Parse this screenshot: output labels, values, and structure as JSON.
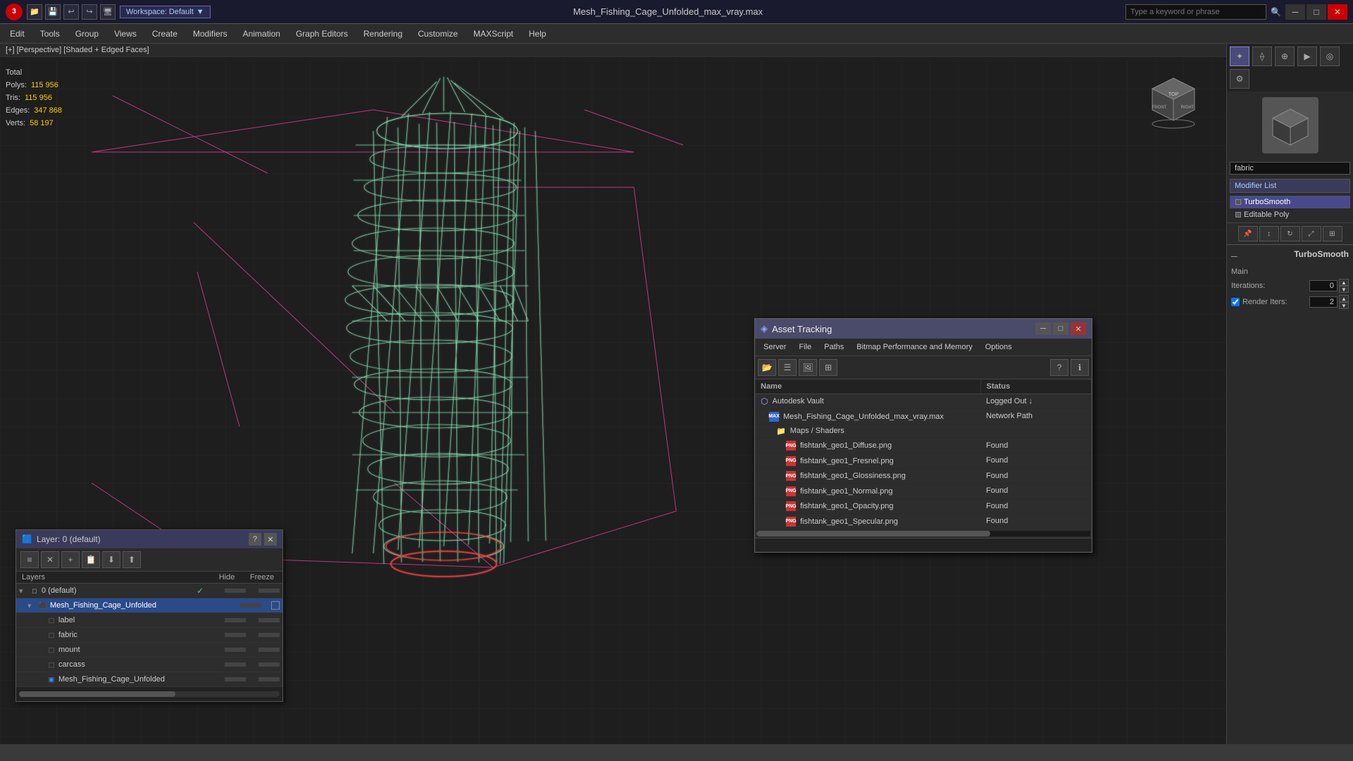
{
  "titleBar": {
    "logoText": "3",
    "quickAccess": [
      "📁",
      "💾",
      "↩",
      "↪",
      "🖥"
    ],
    "workspace": "Workspace: Default",
    "fileTitle": "Mesh_Fishing_Cage_Unfolded_max_vray.max",
    "searchPlaceholder": "Type a keyword or phrase",
    "winControls": [
      "─",
      "□",
      "✕"
    ]
  },
  "menuBar": {
    "items": [
      "Edit",
      "Tools",
      "Group",
      "Views",
      "Create",
      "Modifiers",
      "Animation",
      "Graph Editors",
      "Rendering",
      "Customize",
      "MAXScript",
      "Help"
    ]
  },
  "viewportLabel": "[+] [Perspective] [Shaded + Edged Faces]",
  "stats": {
    "total": "Total",
    "polys": {
      "label": "Polys:",
      "value": "115 956"
    },
    "tris": {
      "label": "Tris:",
      "value": "115 956"
    },
    "edges": {
      "label": "Edges:",
      "value": "347 868"
    },
    "verts": {
      "label": "Verts:",
      "value": "58 197"
    }
  },
  "rightPanel": {
    "modifierSearch": "fabric",
    "modifierListLabel": "Modifier List",
    "modifiers": [
      {
        "name": "TurboSmooth",
        "selected": true
      },
      {
        "name": "Editable Poly",
        "selected": false
      }
    ],
    "turboSmooth": {
      "title": "TurboSmooth",
      "section": "Main",
      "iterations": {
        "label": "Iterations:",
        "value": "0"
      },
      "renderIters": {
        "label": "Render Iters:",
        "value": "2"
      }
    }
  },
  "layerPanel": {
    "title": "Layer: 0 (default)",
    "toolbar": [
      "≡≡",
      "✕",
      "+",
      "📋",
      "⬇",
      "⬆"
    ],
    "columns": {
      "name": "Layers",
      "hide": "Hide",
      "freeze": "Freeze"
    },
    "items": [
      {
        "indent": 0,
        "name": "0 (default)",
        "check": "✓",
        "hasFreeze": true,
        "hasBox": false
      },
      {
        "indent": 1,
        "name": "Mesh_Fishing_Cage_Unfolded",
        "selected": true,
        "check": "",
        "hasFreeze": true,
        "hasBox": true
      },
      {
        "indent": 2,
        "name": "label",
        "check": "",
        "hasFreeze": true,
        "hasBox": false
      },
      {
        "indent": 2,
        "name": "fabric",
        "check": "",
        "hasFreeze": true,
        "hasBox": false
      },
      {
        "indent": 2,
        "name": "mount",
        "check": "",
        "hasFreeze": true,
        "hasBox": false
      },
      {
        "indent": 2,
        "name": "carcass",
        "check": "",
        "hasFreeze": true,
        "hasBox": false
      },
      {
        "indent": 2,
        "name": "Mesh_Fishing_Cage_Unfolded",
        "check": "",
        "hasFreeze": true,
        "hasBox": false
      }
    ]
  },
  "assetPanel": {
    "title": "Asset Tracking",
    "menuItems": [
      "Server",
      "File",
      "Paths",
      "Bitmap Performance and Memory",
      "Options"
    ],
    "toolbar": [
      "📂",
      "📋",
      "🖼",
      "☰"
    ],
    "columns": {
      "name": "Name",
      "status": "Status"
    },
    "groups": [
      {
        "name": "Autodesk Vault",
        "icon": "vault",
        "status": "Logged Out ↓",
        "children": [
          {
            "name": "Mesh_Fishing_Cage_Unfolded_max_vray.max",
            "icon": "max-file",
            "status": "Network Path"
          },
          {
            "name": "Maps / Shaders",
            "icon": "folder",
            "status": "",
            "children": [
              {
                "name": "fishtank_geo1_Diffuse.png",
                "icon": "png",
                "status": "Found"
              },
              {
                "name": "fishtank_geo1_Fresnel.png",
                "icon": "png",
                "status": "Found"
              },
              {
                "name": "fishtank_geo1_Glossiness.png",
                "icon": "png",
                "status": "Found"
              },
              {
                "name": "fishtank_geo1_Normal.png",
                "icon": "png",
                "status": "Found"
              },
              {
                "name": "fishtank_geo1_Opacity.png",
                "icon": "png",
                "status": "Found"
              },
              {
                "name": "fishtank_geo1_Specular.png",
                "icon": "png",
                "status": "Found"
              }
            ]
          }
        ]
      }
    ]
  },
  "colors": {
    "accent": "#4a4a8a",
    "statusFound": "#88cc88",
    "statValue": "#ffcc00",
    "selectionPink": "#ff44aa",
    "background": "#1e1e1e",
    "panelBg": "#2d2d2d"
  }
}
